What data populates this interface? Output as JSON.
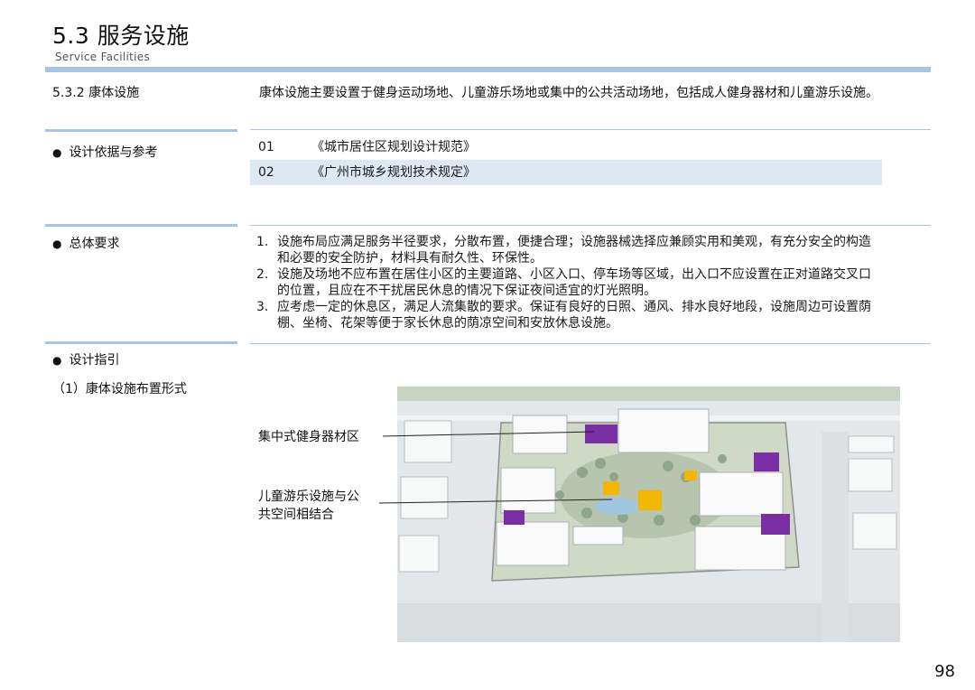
{
  "header": {
    "title": "5.3  服务设施",
    "subtitle": "Service  Facilities"
  },
  "section": {
    "label": "5.3.2 康体设施",
    "description": "康体设施主要设置于健身运动场地、儿童游乐场地或集中的公共活动场地，包括成人健身器材和儿童游乐设施。"
  },
  "references": {
    "label": "设计依据与参考",
    "items": [
      {
        "num": "01",
        "text": "《城市居住区规划设计规范》"
      },
      {
        "num": "02",
        "text": "《广州市城乡规划技术规定》"
      }
    ]
  },
  "requirements": {
    "label": "总体要求",
    "items": [
      {
        "num": "1.",
        "text": "设施布局应满足服务半径要求，分散布置，便捷合理；设施器械选择应兼顾实用和美观，有充分安全的构造和必要的安全防护，材料具有耐久性、环保性。"
      },
      {
        "num": "2.",
        "text": "设施及场地不应布置在居住小区的主要道路、小区入口、停车场等区域，出入口不应设置在正对道路交叉口的位置，且应在不干扰居民休息的情况下保证夜间适宜的灯光照明。"
      },
      {
        "num": "3.",
        "text": "应考虑一定的休息区，满足人流集散的要求。保证有良好的日照、通风、排水良好地段，设施周边可设置荫棚、坐椅、花架等便于家长休息的荫凉空间和安放休息设施。"
      }
    ]
  },
  "guide": {
    "label": "设计指引",
    "sub_label": "（1）康体设施布置形式"
  },
  "callouts": {
    "fitness": "集中式健身器材区",
    "children_line1": "儿童游乐设施与公",
    "children_line2": "共空间相结合"
  },
  "colors": {
    "accent": "#a9c3e2",
    "highlight_row": "#dde8f5",
    "fitness_marker": "#7a2ea3",
    "children_marker": "#f2b705"
  },
  "page_number": "98"
}
